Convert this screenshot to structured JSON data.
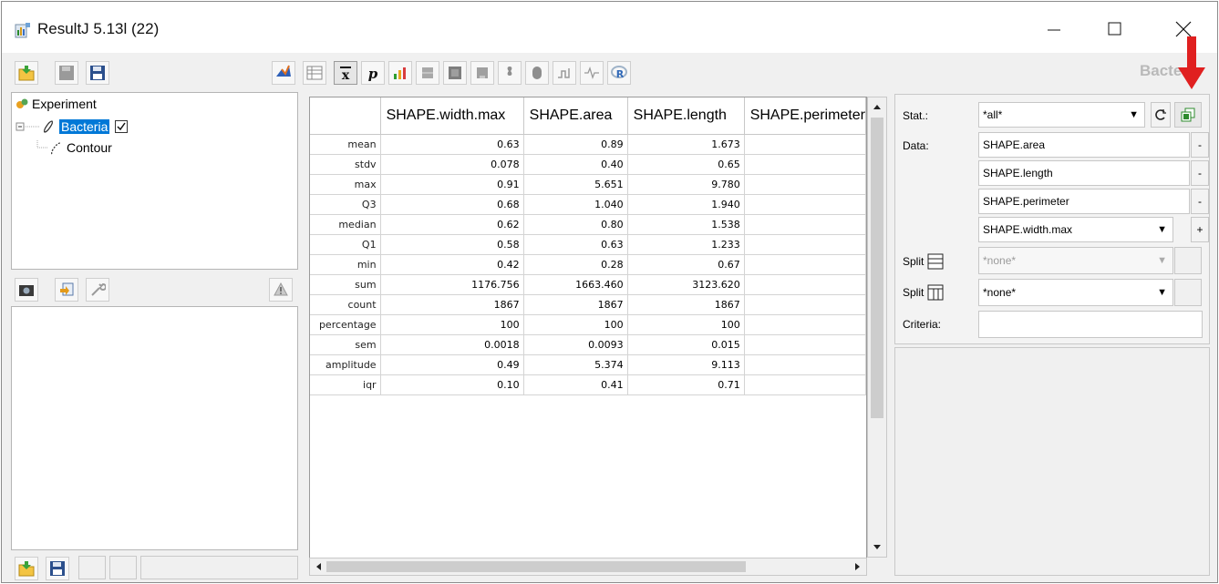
{
  "window": {
    "title": "ResultJ 5.13l (22)"
  },
  "header": {
    "object_label": "Bacteria"
  },
  "tree": {
    "root_label": "Experiment",
    "child_label": "Bacteria",
    "grandchild_label": "Contour",
    "child_checked": true
  },
  "table": {
    "columns": [
      "",
      "SHAPE.width.max",
      "SHAPE.area",
      "SHAPE.length",
      "SHAPE.perimeter"
    ],
    "rows": [
      [
        "mean",
        "0.63",
        "0.89",
        "1.673"
      ],
      [
        "stdv",
        "0.078",
        "0.40",
        "0.65"
      ],
      [
        "max",
        "0.91",
        "5.651",
        "9.780"
      ],
      [
        "Q3",
        "0.68",
        "1.040",
        "1.940"
      ],
      [
        "median",
        "0.62",
        "0.80",
        "1.538"
      ],
      [
        "Q1",
        "0.58",
        "0.63",
        "1.233"
      ],
      [
        "min",
        "0.42",
        "0.28",
        "0.67"
      ],
      [
        "sum",
        "1176.756",
        "1663.460",
        "3123.620"
      ],
      [
        "count",
        "1867",
        "1867",
        "1867"
      ],
      [
        "percentage",
        "100",
        "100",
        "100"
      ],
      [
        "sem",
        "0.0018",
        "0.0093",
        "0.015"
      ],
      [
        "amplitude",
        "0.49",
        "5.374",
        "9.113"
      ],
      [
        "iqr",
        "0.10",
        "0.41",
        "0.71"
      ]
    ]
  },
  "right_panel": {
    "stat_label": "Stat.:",
    "stat_value": "*all*",
    "data_label": "Data:",
    "data_items": [
      "SHAPE.area",
      "SHAPE.length",
      "SHAPE.perimeter",
      "SHAPE.width.max"
    ],
    "remove_glyph": "-",
    "add_glyph": "+",
    "split_label": "Split",
    "split_rows_value": "*none*",
    "split_cols_value": "*none*",
    "criteria_label": "Criteria:",
    "criteria_value": ""
  },
  "colors": {
    "selection": "#0078d7",
    "annotation_arrow": "#e02020"
  }
}
